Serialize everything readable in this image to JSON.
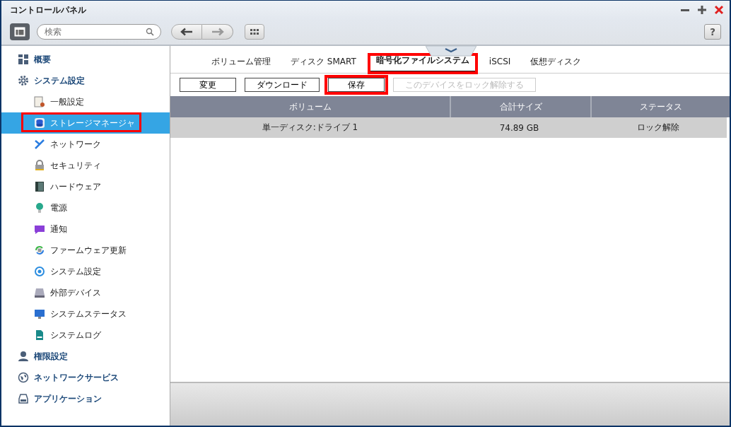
{
  "window": {
    "title": "コントロールパネル"
  },
  "toolbar": {
    "search": {
      "placeholder": "検索"
    },
    "help": "?"
  },
  "sidebar": {
    "sections": [
      {
        "label": "概要"
      },
      {
        "label": "システム設定",
        "children": [
          {
            "label": "一般設定",
            "selected": false,
            "highlighted": false
          },
          {
            "label": "ストレージマネージャ",
            "selected": true,
            "highlighted": true
          },
          {
            "label": "ネットワーク",
            "selected": false,
            "highlighted": false
          },
          {
            "label": "セキュリティ",
            "selected": false,
            "highlighted": false
          },
          {
            "label": "ハードウェア",
            "selected": false,
            "highlighted": false
          },
          {
            "label": "電源",
            "selected": false,
            "highlighted": false
          },
          {
            "label": "通知",
            "selected": false,
            "highlighted": false
          },
          {
            "label": "ファームウェア更新",
            "selected": false,
            "highlighted": false
          },
          {
            "label": "システム設定",
            "selected": false,
            "highlighted": false
          },
          {
            "label": "外部デバイス",
            "selected": false,
            "highlighted": false
          },
          {
            "label": "システムステータス",
            "selected": false,
            "highlighted": false
          },
          {
            "label": "システムログ",
            "selected": false,
            "highlighted": false
          }
        ]
      },
      {
        "label": "権限設定"
      },
      {
        "label": "ネットワークサービス"
      },
      {
        "label": "アプリケーション"
      }
    ]
  },
  "tabs": [
    {
      "label": "ボリューム管理",
      "selected": false,
      "highlighted": false
    },
    {
      "label": "ディスク SMART",
      "selected": false,
      "highlighted": false
    },
    {
      "label": "暗号化ファイルシステム",
      "selected": true,
      "highlighted": true
    },
    {
      "label": "iSCSI",
      "selected": false,
      "highlighted": false
    },
    {
      "label": "仮想ディスク",
      "selected": false,
      "highlighted": false
    }
  ],
  "buttons": [
    {
      "label": "変更",
      "disabled": false,
      "highlighted": false
    },
    {
      "label": "ダウンロード",
      "disabled": false,
      "highlighted": false
    },
    {
      "label": "保存",
      "disabled": false,
      "highlighted": true
    },
    {
      "label": "このデバイスをロック解除する",
      "disabled": true,
      "highlighted": false
    }
  ],
  "table": {
    "columns": [
      "ボリューム",
      "合計サイズ",
      "ステータス"
    ],
    "rows": [
      {
        "cells": [
          "単一ディスク:ドライブ 1",
          "74.89 GB",
          "ロック解除"
        ],
        "selected": true
      }
    ]
  }
}
